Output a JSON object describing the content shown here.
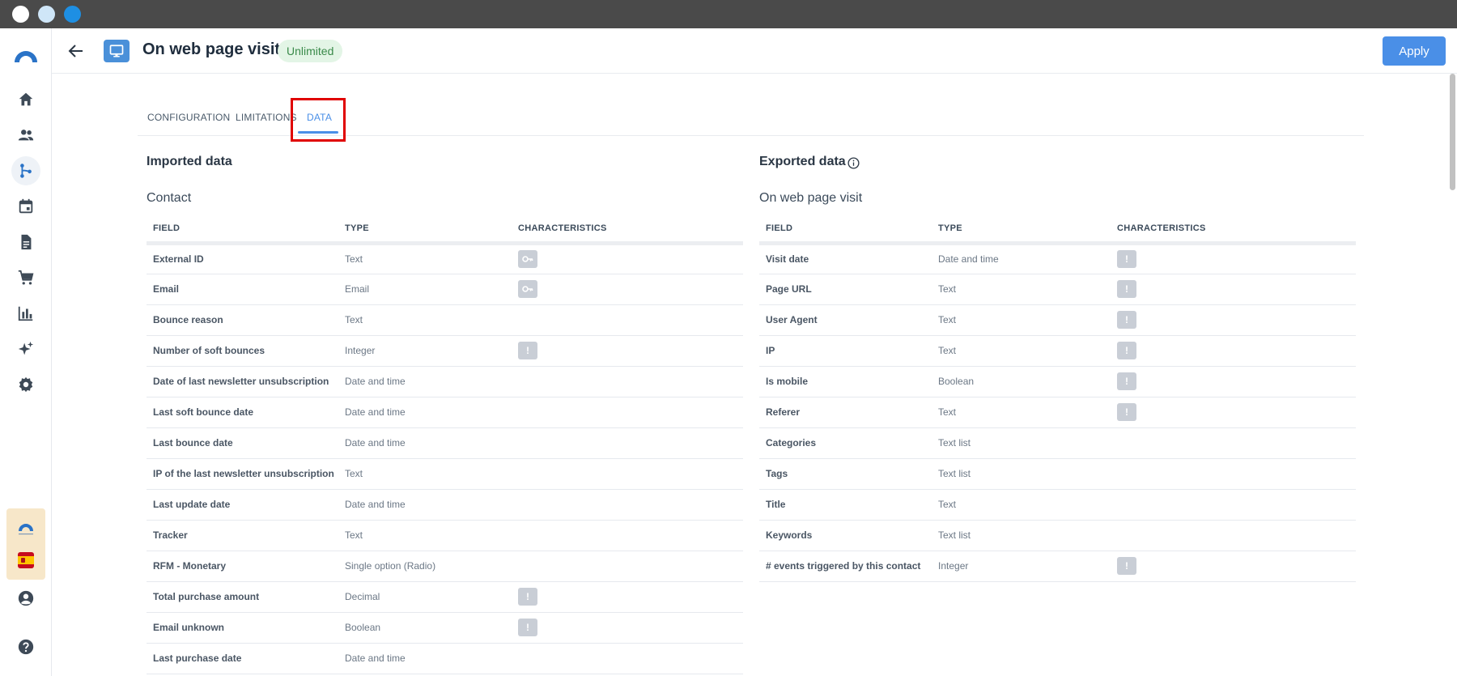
{
  "header": {
    "title": "On web page visit",
    "badge": "Unlimited",
    "apply_label": "Apply"
  },
  "tabs": [
    {
      "label": "CONFIGURATION"
    },
    {
      "label": "LIMITATIONS"
    },
    {
      "label": "DATA",
      "active": true
    }
  ],
  "imported": {
    "title": "Imported data",
    "entity": "Contact",
    "columns": [
      "FIELD",
      "TYPE",
      "CHARACTERISTICS"
    ],
    "rows": [
      {
        "field": "External ID",
        "type": "Text",
        "char": "key-icon"
      },
      {
        "field": "Email",
        "type": "Email",
        "char": "key-icon"
      },
      {
        "field": "Bounce reason",
        "type": "Text",
        "char": ""
      },
      {
        "field": "Number of soft bounces",
        "type": "Integer",
        "char": "warning-icon"
      },
      {
        "field": "Date of last newsletter unsubscription",
        "type": "Date and time",
        "char": ""
      },
      {
        "field": "Last soft bounce date",
        "type": "Date and time",
        "char": ""
      },
      {
        "field": "Last bounce date",
        "type": "Date and time",
        "char": ""
      },
      {
        "field": "IP of the last newsletter unsubscription",
        "type": "Text",
        "char": ""
      },
      {
        "field": "Last update date",
        "type": "Date and time",
        "char": ""
      },
      {
        "field": "Tracker",
        "type": "Text",
        "char": ""
      },
      {
        "field": "RFM - Monetary",
        "type": "Single option (Radio)",
        "char": ""
      },
      {
        "field": "Total purchase amount",
        "type": "Decimal",
        "char": "warning-icon"
      },
      {
        "field": "Email unknown",
        "type": "Boolean",
        "char": "warning-icon"
      },
      {
        "field": "Last purchase date",
        "type": "Date and time",
        "char": ""
      }
    ]
  },
  "exported": {
    "title": "Exported data",
    "entity": "On web page visit",
    "columns": [
      "FIELD",
      "TYPE",
      "CHARACTERISTICS"
    ],
    "rows": [
      {
        "field": "Visit date",
        "type": "Date and time",
        "char": "warning-icon"
      },
      {
        "field": "Page URL",
        "type": "Text",
        "char": "warning-icon"
      },
      {
        "field": "User Agent",
        "type": "Text",
        "char": "warning-icon"
      },
      {
        "field": "IP",
        "type": "Text",
        "char": "warning-icon"
      },
      {
        "field": "Is mobile",
        "type": "Boolean",
        "char": "warning-icon"
      },
      {
        "field": "Referer",
        "type": "Text",
        "char": "warning-icon"
      },
      {
        "field": "Categories",
        "type": "Text list",
        "char": ""
      },
      {
        "field": "Tags",
        "type": "Text list",
        "char": ""
      },
      {
        "field": "Title",
        "type": "Text",
        "char": ""
      },
      {
        "field": "Keywords",
        "type": "Text list",
        "char": ""
      },
      {
        "field": "# events triggered by this contact",
        "type": "Integer",
        "char": "warning-icon"
      }
    ]
  },
  "colors": {
    "accent": "#4a8fe7",
    "highlight": "#e00000",
    "badge_bg": "#e3f5e6",
    "chip": "#c9ced6"
  }
}
